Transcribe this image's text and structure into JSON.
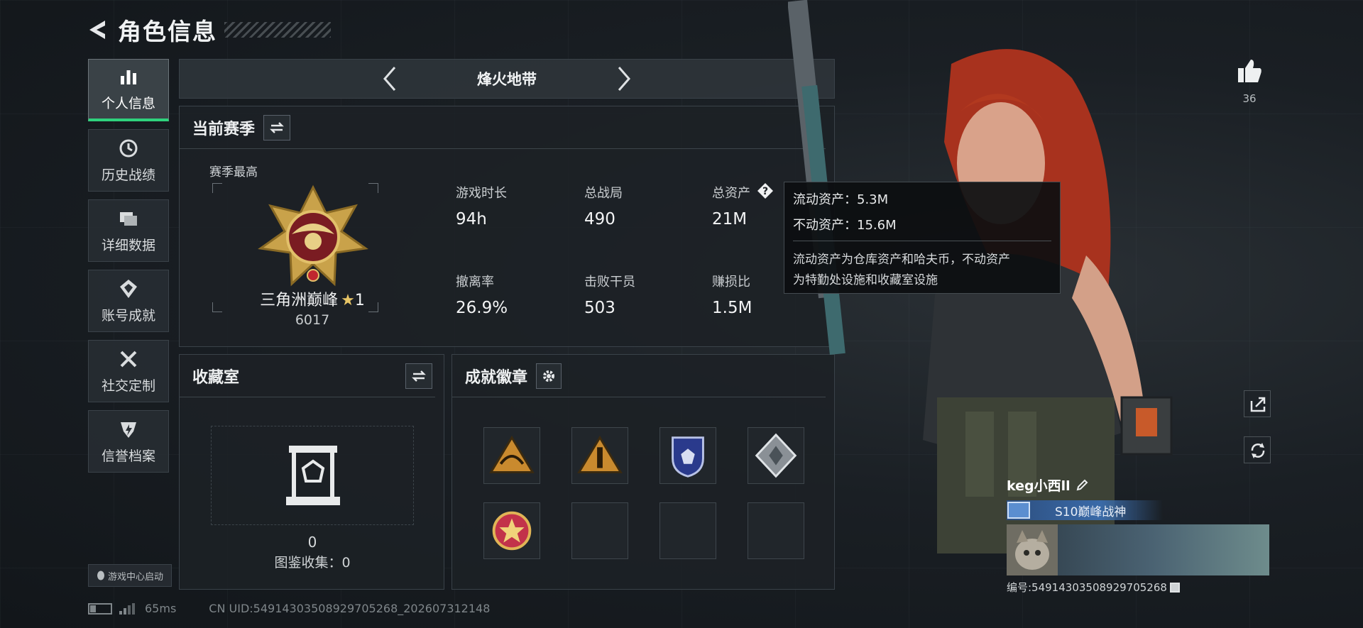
{
  "header": {
    "title": "角色信息"
  },
  "sidebar": {
    "items": [
      {
        "label": "个人信息",
        "icon": "bar-chart-icon",
        "active": true
      },
      {
        "label": "历史战绩",
        "icon": "history-clock-icon",
        "active": false
      },
      {
        "label": "详细数据",
        "icon": "folders-icon",
        "active": false
      },
      {
        "label": "账号成就",
        "icon": "achievement-icon",
        "active": false
      },
      {
        "label": "社交定制",
        "icon": "tools-icon",
        "active": false
      },
      {
        "label": "信誉档案",
        "icon": "credit-shield-icon",
        "active": false
      }
    ],
    "game_center": "游戏中心启动"
  },
  "mode": {
    "title": "烽火地带"
  },
  "season": {
    "title": "当前赛季",
    "best_label": "赛季最高",
    "rank_name": "三角洲巅峰",
    "rank_star": "★",
    "rank_level": "1",
    "rank_score": "6017",
    "stats": [
      {
        "label": "游戏时长",
        "value": "94h"
      },
      {
        "label": "总战局",
        "value": "490"
      },
      {
        "label": "总资产",
        "value": "21M"
      },
      {
        "label": "撤离率",
        "value": "26.9%"
      },
      {
        "label": "击败干员",
        "value": "503"
      },
      {
        "label": "赚损比",
        "value": "1.5M"
      }
    ]
  },
  "tooltip": {
    "liquid": "流动资产：5.3M",
    "fixed": "不动资产：15.6M",
    "desc_line1": "流动资产为仓库资产和哈夫币，不动资产",
    "desc_line2": "为特勤处设施和收藏室设施"
  },
  "collection": {
    "title": "收藏室",
    "count": "0",
    "total": "图鉴收集：0"
  },
  "achievements": {
    "title": "成就徽章",
    "badges": [
      "triangle-gold-badge",
      "triangle-tower-badge",
      "blue-shield-badge",
      "diamond-silver-badge",
      "star-medal-badge",
      "",
      "",
      ""
    ]
  },
  "status": {
    "ping": "65ms",
    "uid": "CN UID:5491430350892970526​8_202607312148"
  },
  "profile": {
    "likes": "36",
    "name": "keg小西ll",
    "title": "S10巅峰战神",
    "id": "编号:5491430350892970526​8"
  }
}
